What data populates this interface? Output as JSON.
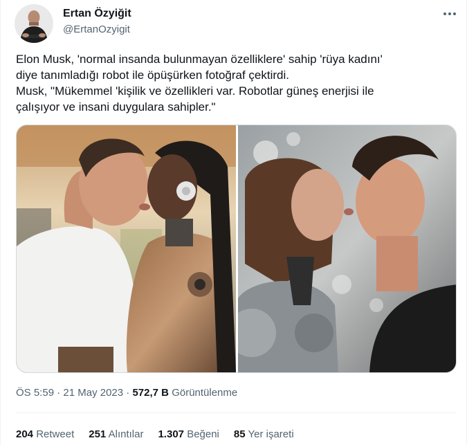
{
  "author": {
    "name": "Ertan Özyiğit",
    "handle": "@ErtanOzyigit"
  },
  "tweet": {
    "text_lines": [
      "Elon Musk, 'normal insanda bulunmayan özelliklere' sahip 'rüya kadını'",
      "diye tanımladığı robot ile öpüşürken fotoğraf çektirdi.",
      "Musk, \"Mükemmel 'kişilik ve özellikleri var. Robotlar güneş enerjisi ile",
      "çalışıyor ve insani duygulara sahipler.\""
    ]
  },
  "meta": {
    "time": "ÖS 5:59",
    "separator1": " · ",
    "date": "21 May 2023",
    "separator2": " · ",
    "views_count": "572,7 B",
    "views_label": "Görüntülenme"
  },
  "stats": [
    {
      "count": "204",
      "label": "Retweet"
    },
    {
      "count": "251",
      "label": "Alıntılar"
    },
    {
      "count": "1.307",
      "label": "Beğeni"
    },
    {
      "count": "85",
      "label": "Yer işareti"
    }
  ],
  "icons": {
    "more": "more-horizontal-icon"
  },
  "colors": {
    "text": "#0f1419",
    "secondary": "#536471",
    "border": "#eff3f4"
  }
}
